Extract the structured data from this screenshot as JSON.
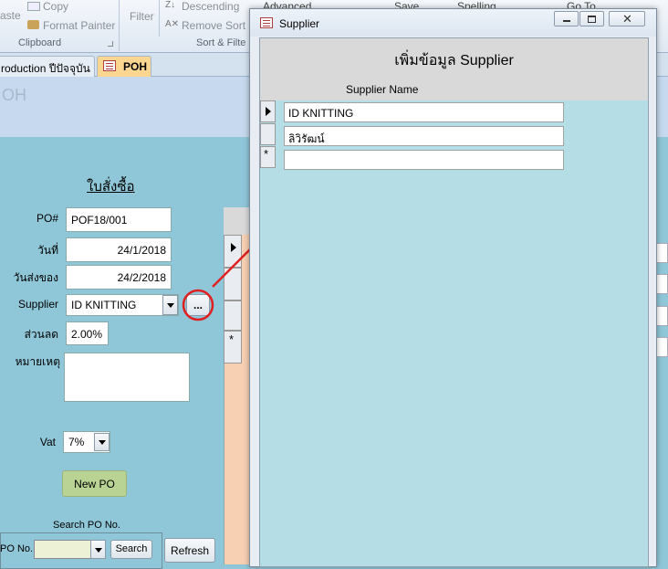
{
  "ribbon": {
    "paste": "aste",
    "copy": "Copy",
    "format_painter": "Format Painter",
    "clipboard_group": "Clipboard",
    "filter": "Filter",
    "descending": "Descending",
    "remove_sort": "Remove Sort",
    "sort_group": "Sort & Filte",
    "advanced": "Advanced",
    "save": "Save",
    "spelling": "Spelling",
    "go_to": "Go To"
  },
  "tabs": [
    {
      "label": "roduction ปีปัจจุบัน"
    },
    {
      "label": "POH"
    }
  ],
  "form": {
    "header_title": "OH",
    "heading": "ใบสั่งซื้อ",
    "po_label": "PO#",
    "po_value": "POF18/001",
    "date_label": "วันที่",
    "date_value": "24/1/2018",
    "delivery_label": "วันส่งของ",
    "delivery_value": "24/2/2018",
    "supplier_label": "Supplier",
    "supplier_value": "ID KNITTING",
    "lookup_button": "...",
    "discount_label": "ส่วนลด",
    "discount_value": "2.00%",
    "note_label": "หมายเหตุ",
    "note_value": "",
    "vat_label": "Vat",
    "vat_value": "7%",
    "new_po_button": "New PO",
    "search_caption": "Search PO No.",
    "po_no_label": "PO No.",
    "search_button": "Search",
    "refresh_button": "Refresh",
    "new_row_marker": "*"
  },
  "popup": {
    "title": "Supplier",
    "heading": "เพิ่มข้อมูล Supplier",
    "column_header": "Supplier Name",
    "rows": [
      "ID KNITTING",
      "ลิวิรัฒน์",
      ""
    ],
    "new_row_marker": "*"
  },
  "colors": {
    "form_background": "#8fc7d9",
    "popup_background": "#b4dde6",
    "annotation_red": "#e02020",
    "active_tab": "#fbd690"
  }
}
